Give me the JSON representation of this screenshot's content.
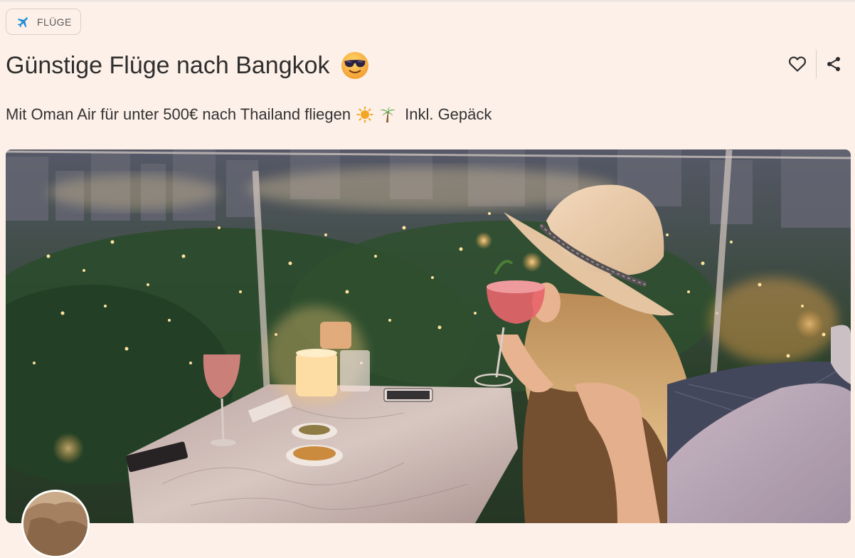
{
  "category": {
    "label": "FLÜGE",
    "icon": "airplane-icon",
    "icon_color": "#1f8dd6"
  },
  "header": {
    "title": "Günstige Flüge nach Bangkok",
    "title_emoji": "smiling-face-with-sunglasses-icon"
  },
  "actions": {
    "favorite_icon": "heart-outline-icon",
    "share_icon": "share-icon"
  },
  "subtitle": {
    "text": "Mit Oman Air für unter 500€ nach Thailand fliegen",
    "emoji_1": "sun-icon",
    "emoji_2": "palm-tree-icon",
    "extra": "Inkl. Gepäck"
  },
  "hero_image": {
    "description_icon": "photo-bangkok-rooftop-bar"
  },
  "author": {
    "avatar_icon": "avatar-photo"
  },
  "colors": {
    "background": "#fdf0e8",
    "text": "#2e2e2e",
    "accent": "#1f8dd6"
  }
}
